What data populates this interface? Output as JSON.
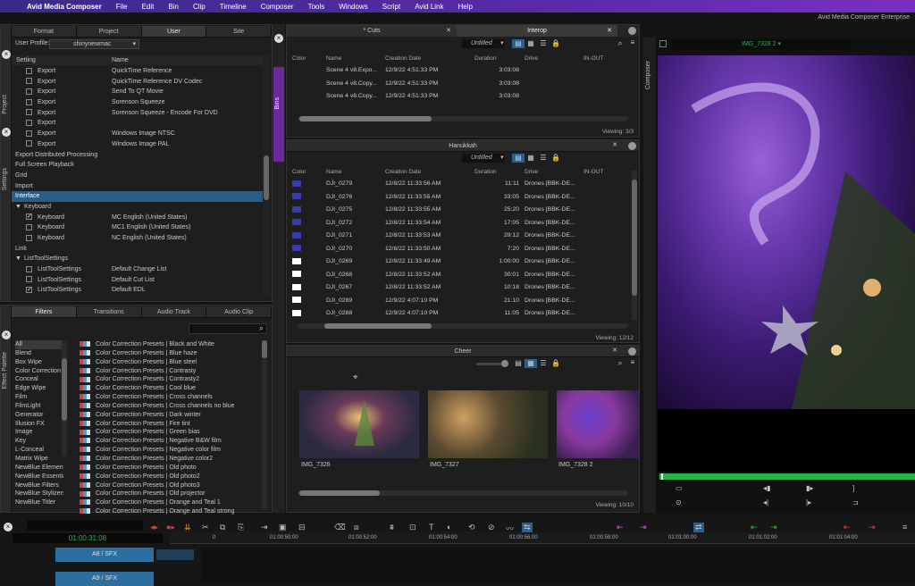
{
  "menubar": {
    "apple": "",
    "app": "Avid Media Composer",
    "items": [
      "File",
      "Edit",
      "Bin",
      "Clip",
      "Timeline",
      "Composer",
      "Tools",
      "Windows",
      "Script",
      "Avid Link",
      "Help"
    ]
  },
  "window_title": "Avid Media Composer Enterprise",
  "settings": {
    "tabs": [
      "Format",
      "Project",
      "User",
      "Site"
    ],
    "active_tab": "User",
    "user_profile_label": "User Profile:",
    "user_profile_value": "shinynewmac",
    "col_setting": "Setting",
    "col_name": "Name",
    "side_labels": [
      "Project",
      "Settings"
    ],
    "rows": [
      {
        "indent": 1,
        "check": false,
        "setting": "Export",
        "name": "QuickTime Reference"
      },
      {
        "indent": 1,
        "check": false,
        "setting": "Export",
        "name": "QuickTime Reference DV Codec"
      },
      {
        "indent": 1,
        "check": false,
        "setting": "Export",
        "name": "Send To QT Movie"
      },
      {
        "indent": 1,
        "check": false,
        "setting": "Export",
        "name": "Sorenson Squeeze"
      },
      {
        "indent": 1,
        "check": false,
        "setting": "Export",
        "name": "Sorenson Squeeze - Encode For DVD"
      },
      {
        "indent": 1,
        "check": false,
        "setting": "Export",
        "name": ""
      },
      {
        "indent": 1,
        "check": false,
        "setting": "Export",
        "name": "Windows Image NTSC"
      },
      {
        "indent": 1,
        "check": false,
        "setting": "Export",
        "name": "Windows Image PAL"
      },
      {
        "indent": 0,
        "check": null,
        "setting": "Export Distributed Processing",
        "name": ""
      },
      {
        "indent": 0,
        "check": null,
        "setting": "Full Screen Playback",
        "name": ""
      },
      {
        "indent": 0,
        "check": null,
        "setting": "Grid",
        "name": ""
      },
      {
        "indent": 0,
        "check": null,
        "setting": "Import",
        "name": ""
      },
      {
        "indent": 0,
        "check": null,
        "setting": "Interface",
        "name": "",
        "selected": true
      },
      {
        "indent": 0,
        "check": null,
        "setting": "Keyboard",
        "name": "",
        "expander": "▼"
      },
      {
        "indent": 1,
        "check": true,
        "setting": "Keyboard",
        "name": "MC English (United States)"
      },
      {
        "indent": 1,
        "check": false,
        "setting": "Keyboard",
        "name": "MC1 English (United States)"
      },
      {
        "indent": 1,
        "check": false,
        "setting": "Keyboard",
        "name": "NC English (United States)"
      },
      {
        "indent": 0,
        "check": null,
        "setting": "Link",
        "name": ""
      },
      {
        "indent": 0,
        "check": null,
        "setting": "ListToolSettings",
        "name": "",
        "expander": "▼"
      },
      {
        "indent": 1,
        "check": false,
        "setting": "ListToolSettings",
        "name": "Default Change List"
      },
      {
        "indent": 1,
        "check": false,
        "setting": "ListToolSettings",
        "name": "Default Cut List"
      },
      {
        "indent": 1,
        "check": true,
        "setting": "ListToolSettings",
        "name": "Default EDL"
      }
    ]
  },
  "effects": {
    "tabs": [
      "Filters",
      "Transitions",
      "Audio Track",
      "Audio Clip"
    ],
    "active_tab": "Filters",
    "side_label": "Effect Palette",
    "categories": [
      "All",
      "Blend",
      "Box Wipe",
      "Color Correction",
      "Conceal",
      "Edge Wipe",
      "Film",
      "FilmLight",
      "Generator",
      "Illusion FX",
      "Image",
      "Key",
      "L-Conceal",
      "Matrix Wipe",
      "NewBlue Elements",
      "NewBlue Essentials",
      "NewBlue Filters",
      "NewBlue Stylizers",
      "NewBlue Titler"
    ],
    "items": [
      "Color Correction Presets | Black and White",
      "Color Correction Presets | Blue haze",
      "Color Correction Presets | Blue steel",
      "Color Correction Presets | Contrasty",
      "Color Correction Presets | Contrasty2",
      "Color Correction Presets | Cool blue",
      "Color Correction Presets | Cross channels",
      "Color Correction Presets | Cross channels no blue",
      "Color Correction Presets | Dark winter",
      "Color Correction Presets | Fire tint",
      "Color Correction Presets | Green bias",
      "Color Correction Presets | Negative B&W film",
      "Color Correction Presets | Negative color film",
      "Color Correction Presets | Negative color2",
      "Color Correction Presets | Old photo",
      "Color Correction Presets | Old photo2",
      "Color Correction Presets | Old photo3",
      "Color Correction Presets | Old projector",
      "Color Correction Presets | Orange and Teal 1",
      "Color Correction Presets | Orange and Teal strong"
    ]
  },
  "bins_label": "Bins",
  "interop": {
    "tabs": [
      "* Cuts",
      "Interop"
    ],
    "active_tab": "Interop",
    "view_name": "Untitled",
    "cols": [
      "Color",
      "Name",
      "Creation Date",
      "Duration",
      "Drive",
      "IN-OUT"
    ],
    "rows": [
      {
        "name": "Scene 4 v8.Expo...",
        "date": "12/9/22 4:51:33 PM",
        "dur": "3:03:08"
      },
      {
        "name": "Scene 4 v8.Copy...",
        "date": "12/9/22 4:51:33 PM",
        "dur": "3:03:08"
      },
      {
        "name": "Scene 4 v8.Copy...",
        "date": "12/9/22 4:51:33 PM",
        "dur": "3:03:08"
      }
    ],
    "viewing": "Viewing: 3/3"
  },
  "hanukkah": {
    "title": "Hanukkah",
    "view_name": "Untitled",
    "cols": [
      "Color",
      "Name",
      "Creation Date",
      "Duration",
      "Drive",
      "IN-OUT"
    ],
    "rows": [
      {
        "color": "#3a3ab0",
        "name": "DJI_0279",
        "date": "12/8/22 11:33:56 AM",
        "dur": "11:11",
        "drive": "Drones [BBK-DE..."
      },
      {
        "color": "#3a3ab0",
        "name": "DJI_0276",
        "date": "12/8/22 11:33:55 AM",
        "dur": "33:05",
        "drive": "Drones [BBK-DE..."
      },
      {
        "color": "#3a3ab0",
        "name": "DJI_0275",
        "date": "12/8/22 11:33:55 AM",
        "dur": "25:20",
        "drive": "Drones [BBK-DE..."
      },
      {
        "color": "#3a3ab0",
        "name": "DJI_0272",
        "date": "12/8/22 11:33:54 AM",
        "dur": "17:05",
        "drive": "Drones [BBK-DE..."
      },
      {
        "color": "#3a3ab0",
        "name": "DJI_0271",
        "date": "12/8/22 11:33:53 AM",
        "dur": "29:12",
        "drive": "Drones [BBK-DE..."
      },
      {
        "color": "#3a3ab0",
        "name": "DJI_0270",
        "date": "12/8/22 11:33:50 AM",
        "dur": "7:20",
        "drive": "Drones [BBK-DE..."
      },
      {
        "color": "#ffffff",
        "name": "DJI_0269",
        "date": "12/8/22 11:33:49 AM",
        "dur": "1:00:00",
        "drive": "Drones [BBK-DE..."
      },
      {
        "color": "#ffffff",
        "name": "DJI_0268",
        "date": "12/8/22 11:33:52 AM",
        "dur": "30:01",
        "drive": "Drones [BBK-DE..."
      },
      {
        "color": "#ffffff",
        "name": "DJI_0267",
        "date": "12/8/22 11:33:52 AM",
        "dur": "10:18",
        "drive": "Drones [BBK-DE..."
      },
      {
        "color": "#ffffff",
        "name": "DJI_0289",
        "date": "12/9/22 4:07:10 PM",
        "dur": "21:10",
        "drive": "Drones [BBK-DE..."
      },
      {
        "color": "#ffffff",
        "name": "DJI_0288",
        "date": "12/9/22 4:07:10 PM",
        "dur": "11:05",
        "drive": "Drones [BBK-DE..."
      }
    ],
    "viewing": "Viewing: 12/12"
  },
  "cheer": {
    "title": "Cheer",
    "clips": [
      "IMG_7326",
      "IMG_7327",
      "IMG_7328 2"
    ],
    "viewing": "Viewing: 10/10"
  },
  "composer": {
    "side_label": "Composer",
    "clip_name": "IMG_7328 2"
  },
  "timeline": {
    "timecode": "01:00:31:08",
    "ruler": [
      "0",
      "01:00:50:00",
      "01:00:52:00",
      "01:00:54:00",
      "01:00:56:00",
      "01:00:58:00",
      "01:01:00:00",
      "01:01:02:00",
      "01:01:04:00"
    ],
    "tracks": [
      "A8 / SFX",
      "A9 / SFX"
    ]
  },
  "colors": {
    "accent": "#2a5d86",
    "menubar": "#5a2aa8",
    "track": "#2c6f9e",
    "green": "#2ab04a"
  }
}
